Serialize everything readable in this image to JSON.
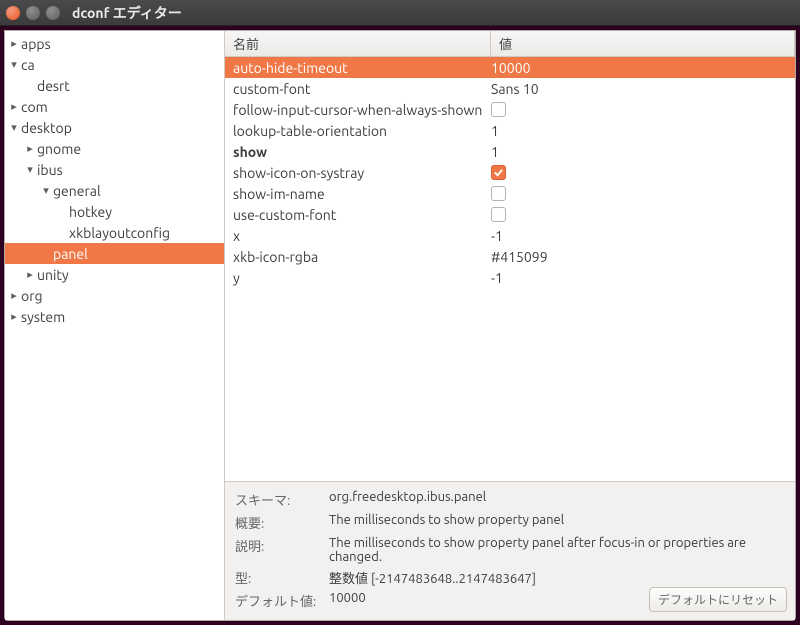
{
  "window": {
    "title": "dconf エディター"
  },
  "tree": [
    {
      "indent": 0,
      "exp": "right",
      "label": "apps"
    },
    {
      "indent": 0,
      "exp": "down",
      "label": "ca"
    },
    {
      "indent": 1,
      "exp": "none",
      "label": "desrt"
    },
    {
      "indent": 0,
      "exp": "right",
      "label": "com"
    },
    {
      "indent": 0,
      "exp": "down",
      "label": "desktop"
    },
    {
      "indent": 1,
      "exp": "right",
      "label": "gnome"
    },
    {
      "indent": 1,
      "exp": "down",
      "label": "ibus"
    },
    {
      "indent": 2,
      "exp": "down",
      "label": "general"
    },
    {
      "indent": 3,
      "exp": "none",
      "label": "hotkey"
    },
    {
      "indent": 3,
      "exp": "none",
      "label": "xkblayoutconfig"
    },
    {
      "indent": 2,
      "exp": "none",
      "label": "panel",
      "selected": true
    },
    {
      "indent": 1,
      "exp": "right",
      "label": "unity"
    },
    {
      "indent": 0,
      "exp": "right",
      "label": "org"
    },
    {
      "indent": 0,
      "exp": "right",
      "label": "system"
    }
  ],
  "columns": {
    "name": "名前",
    "value": "値"
  },
  "rows": [
    {
      "name": "auto-hide-timeout",
      "value": "10000",
      "type": "text",
      "selected": true
    },
    {
      "name": "custom-font",
      "value": "Sans 10",
      "type": "text"
    },
    {
      "name": "follow-input-cursor-when-always-shown",
      "type": "check",
      "checked": false
    },
    {
      "name": "lookup-table-orientation",
      "value": "1",
      "type": "text"
    },
    {
      "name": "show",
      "value": "1",
      "type": "text",
      "bold": true
    },
    {
      "name": "show-icon-on-systray",
      "type": "check",
      "checked": true
    },
    {
      "name": "show-im-name",
      "type": "check",
      "checked": false
    },
    {
      "name": "use-custom-font",
      "type": "check",
      "checked": false
    },
    {
      "name": "x",
      "value": "-1",
      "type": "text"
    },
    {
      "name": "xkb-icon-rgba",
      "value": "#415099",
      "type": "text"
    },
    {
      "name": "y",
      "value": "-1",
      "type": "text"
    }
  ],
  "details": {
    "schema_label": "スキーマ:",
    "schema": "org.freedesktop.ibus.panel",
    "summary_label": "概要:",
    "summary": "The milliseconds to show property panel",
    "description_label": "説明:",
    "description": "The milliseconds to show property panel after focus-in or properties are changed.",
    "type_label": "型:",
    "type": "整数値 [-2147483648..2147483647]",
    "default_label": "デフォルト値:",
    "default": "10000",
    "reset_button": "デフォルトにリセット"
  }
}
